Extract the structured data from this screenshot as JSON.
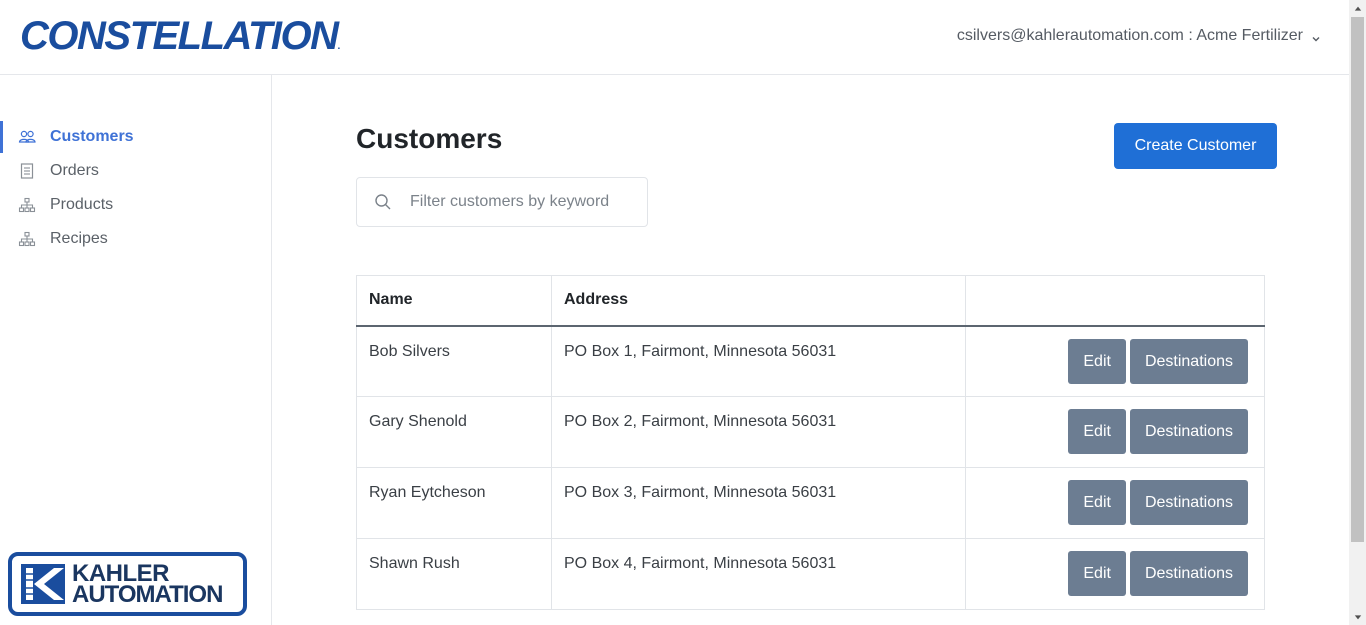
{
  "header": {
    "brand": "CONSTELLATION",
    "brand_mark": ".",
    "account_label": "csilvers@kahlerautomation.com : Acme Fertilizer"
  },
  "sidebar": {
    "items": [
      {
        "label": "Customers",
        "icon": "users-icon",
        "active": true
      },
      {
        "label": "Orders",
        "icon": "receipt-icon",
        "active": false
      },
      {
        "label": "Products",
        "icon": "sitemap-icon",
        "active": false
      },
      {
        "label": "Recipes",
        "icon": "sitemap-icon",
        "active": false
      }
    ],
    "logo": {
      "line1": "KAHLER",
      "line2": "AUTOMATION"
    }
  },
  "main": {
    "title": "Customers",
    "create_button": "Create Customer",
    "search": {
      "placeholder": "Filter customers by keyword",
      "value": ""
    },
    "table": {
      "headers": [
        "Name",
        "Address",
        ""
      ],
      "rows": [
        {
          "name": "Bob Silvers",
          "address": "PO Box 1, Fairmont, Minnesota 56031",
          "edit": "Edit",
          "destinations": "Destinations"
        },
        {
          "name": "Gary Shenold",
          "address": "PO Box 2, Fairmont, Minnesota 56031",
          "edit": "Edit",
          "destinations": "Destinations"
        },
        {
          "name": "Ryan Eytcheson",
          "address": "PO Box 3, Fairmont, Minnesota 56031",
          "edit": "Edit",
          "destinations": "Destinations"
        },
        {
          "name": "Shawn Rush",
          "address": "PO Box 4, Fairmont, Minnesota 56031",
          "edit": "Edit",
          "destinations": "Destinations"
        }
      ]
    }
  },
  "colors": {
    "brand_blue": "#1a4d9e",
    "active_nav": "#3f72d6",
    "primary_button": "#1f6fd6",
    "secondary_button": "#6c7d92"
  }
}
